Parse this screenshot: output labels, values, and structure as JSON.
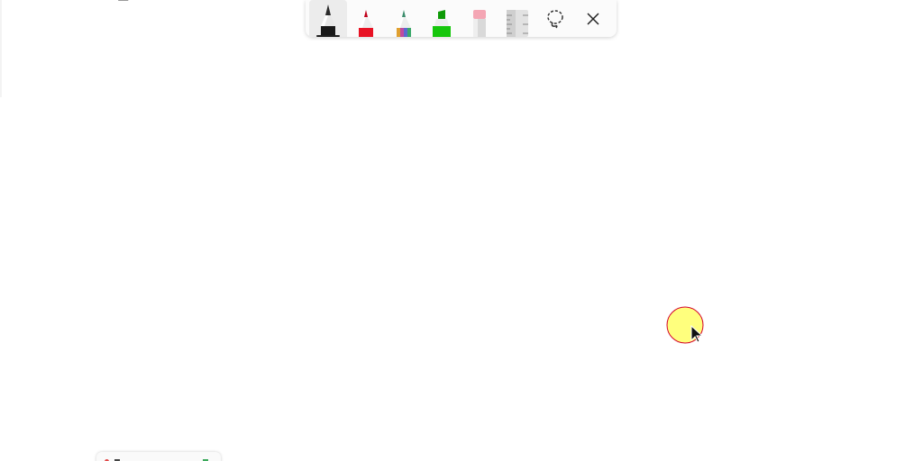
{
  "window": {
    "title": ""
  },
  "toolbar": {
    "tools": [
      {
        "name": "ballpoint-pen",
        "icon": "black-pen-icon",
        "color": "#1a1a1a",
        "selected": true
      },
      {
        "name": "red-pen",
        "icon": "red-pen-icon",
        "color": "#e81224",
        "selected": false
      },
      {
        "name": "galaxy-pen",
        "icon": "rainbow-pen-icon",
        "color": "#8a5cd0",
        "selected": false
      },
      {
        "name": "highlighter",
        "icon": "green-highlighter-icon",
        "color": "#16c60c",
        "selected": false
      },
      {
        "name": "eraser",
        "icon": "eraser-icon",
        "color": "#f4a6b4",
        "selected": false
      },
      {
        "name": "ruler",
        "icon": "ruler-icon",
        "color": "#bdbdbd",
        "selected": false
      }
    ],
    "actions": [
      {
        "name": "lasso-select",
        "icon": "lasso-icon"
      },
      {
        "name": "close",
        "icon": "close-icon"
      }
    ]
  },
  "cursor": {
    "icon": "mouse-pointer-icon",
    "highlight_color": "#ffff66",
    "ring_color": "#d4002a"
  }
}
